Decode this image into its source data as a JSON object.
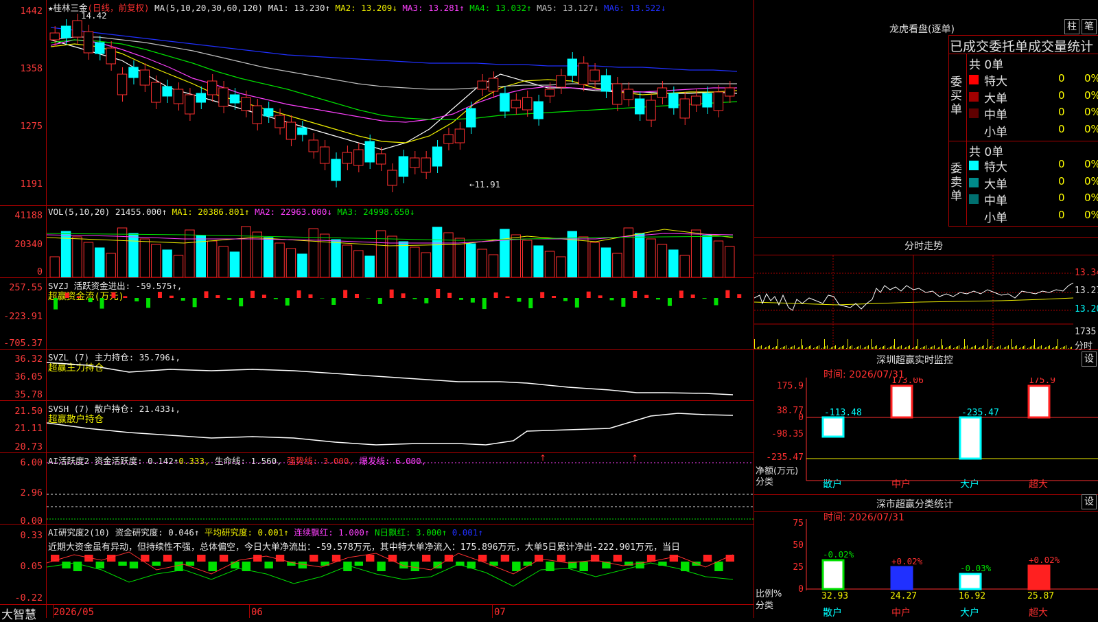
{
  "stock_header": {
    "name": "★桂林三金",
    "mode": "(日线，前复权)",
    "ma_def": "MA(5,10,20,30,60,120)",
    "ma1": "MA1: 13.230↑",
    "ma2": "MA2: 13.209↓",
    "ma3": "MA3: 13.281↑",
    "ma4": "MA4: 13.032↑",
    "ma5": "MA5: 13.127↓",
    "ma6": "MA6: 13.522↓",
    "high_mark": "14.42",
    "low_mark": "←11.91",
    "top_tick": "1442"
  },
  "price_axis": [
    "1358",
    "1275",
    "1191"
  ],
  "vol": {
    "header": "VOL(5,10,20)",
    "val": "21455.000↑",
    "ma1": "MA1: 20386.801↑",
    "ma2": "MA2: 22963.000↓",
    "ma3": "MA3: 24998.650↓",
    "ticks": [
      "41188",
      "20340",
      "0"
    ]
  },
  "svzj": {
    "header": "SVZJ  活跃资金进出: -59.575↑,",
    "sub": "超赢资金流(万元)",
    "ticks": [
      "257.55",
      "-223.91",
      "-705.37"
    ]
  },
  "svzl": {
    "header": "SVZL (7) 主力持仓: 35.796↓,",
    "sub": "超赢主力持仓",
    "ticks": [
      "36.32",
      "36.05",
      "35.78"
    ]
  },
  "svsh": {
    "header": "SVSH (7) 散户持仓: 21.433↓,",
    "sub": "超赢散户持仓",
    "ticks": [
      "21.50",
      "21.11",
      "20.73"
    ]
  },
  "ai1": {
    "header": "AI活跃度2 资金活跃度: 0.142↑",
    "v2": "0.333,",
    "life": "生命线: 1.560,",
    "strong": "强势线: 3.000,",
    "burst": "爆发线: 6.000,",
    "ticks": [
      "6.00",
      "2.96",
      "0.00"
    ]
  },
  "ai2": {
    "header": "AI研究度2(10) 资金研究度: 0.046↑",
    "avg": "平均研究度: 0.001↑",
    "cont": "连续飘红: 1.000↑",
    "nday": "N日飘红: 3.000↑",
    "last": "0.001↑",
    "text": "近期大资金虽有异动，但持续性不强，总体偏空，今日大单净流出：-59.578万元，其中特大单净流入：175.896万元，大单5日累计净出-222.901万元，当日",
    "ticks": [
      "0.33",
      "0.05",
      "-0.22"
    ]
  },
  "footer": {
    "brand": "大智慧",
    "dates": [
      "2026/05",
      "06",
      "07"
    ]
  },
  "right": {
    "title": "龙虎看盘(逐单)",
    "btn1": "柱",
    "btn2": "笔",
    "subtitle": "已成交委托单成交量统计",
    "buy_label": "委买单",
    "sell_label": "委卖单",
    "buy_total": "共 0单",
    "sell_total": "共 0单",
    "buy_rows": [
      {
        "name": "特大",
        "v": "0",
        "p": "0%",
        "color": "#ff0000"
      },
      {
        "name": "大单",
        "v": "0",
        "p": "0%",
        "color": "#a00000"
      },
      {
        "name": "中单",
        "v": "0",
        "p": "0%",
        "color": "#600000"
      },
      {
        "name": "小单",
        "v": "0",
        "p": "0%",
        "color": "#000000"
      }
    ],
    "sell_rows": [
      {
        "name": "特大",
        "v": "0",
        "p": "0%",
        "color": "#00ffff"
      },
      {
        "name": "大单",
        "v": "0",
        "p": "0%",
        "color": "#008b8b"
      },
      {
        "name": "中单",
        "v": "0",
        "p": "0%",
        "color": "#007070"
      },
      {
        "name": "小单",
        "v": "0",
        "p": "0%",
        "color": "#000000"
      }
    ],
    "intraday_title": "分时走势",
    "intraday_ticks": [
      "13.34",
      "13.27",
      "13.20"
    ],
    "intraday_vol": "1735",
    "intraday_unit": "分时",
    "sz_title": "深圳超赢实时监控",
    "sz_set": "设",
    "sz_time": "时间: 2026/07/31",
    "sz_ticks": [
      "175.9",
      "38.77",
      "0",
      "-98.35",
      "-235.47"
    ],
    "sz_unit": "净额(万元)",
    "sz_cat": "分类",
    "sz_vals": [
      "-113.48",
      "173.06",
      "-235.47",
      "175.9"
    ],
    "sz_cats": [
      "散户",
      "中户",
      "大户",
      "超大"
    ],
    "cls_title": "深市超赢分类统计",
    "cls_set": "设",
    "cls_time": "时间: 2026/07/31",
    "cls_ticks": [
      "75",
      "50",
      "25",
      "0"
    ],
    "cls_unit": "比例%",
    "cls_cat": "分类",
    "cls_changes": [
      "-0.02%",
      "+0.02%",
      "-0.03%",
      "+0.02%"
    ],
    "cls_vals": [
      "32.93",
      "24.27",
      "16.92",
      "25.87"
    ],
    "cls_cats": [
      "散户",
      "中户",
      "大户",
      "超大"
    ]
  }
}
